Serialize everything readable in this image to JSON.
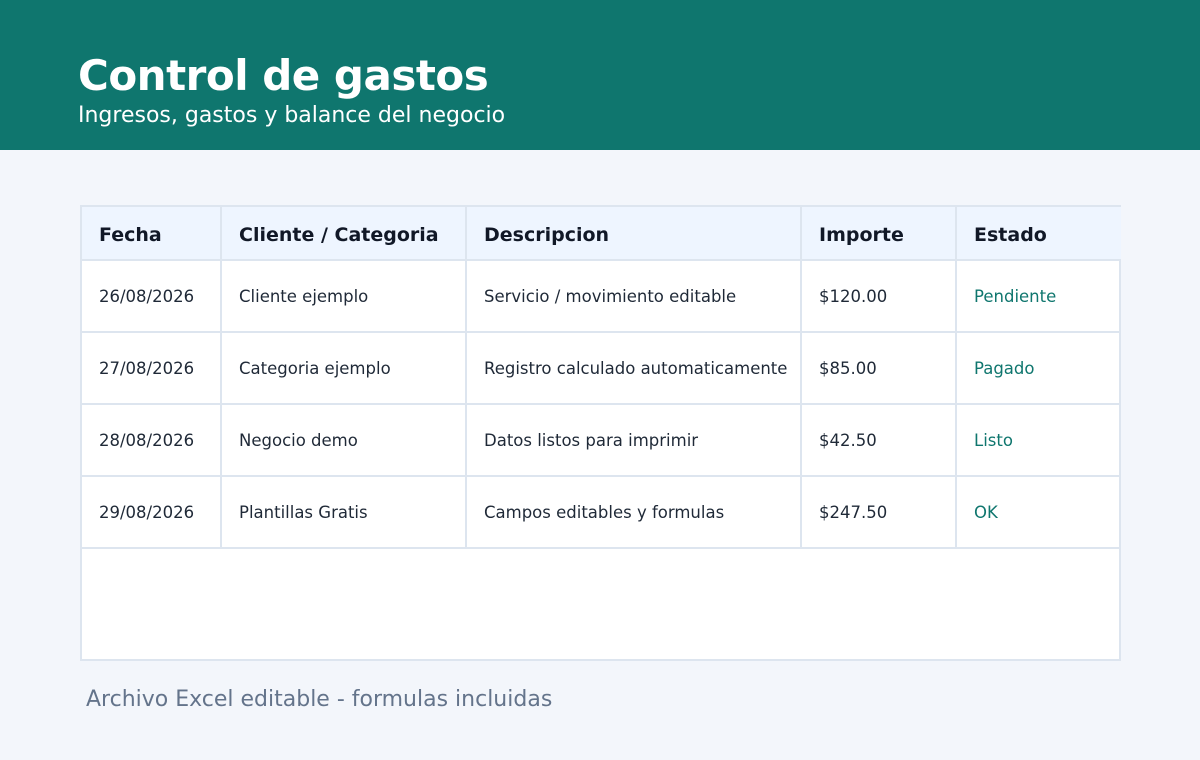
{
  "header": {
    "title": "Control de gastos",
    "subtitle": "Ingresos, gastos y balance del negocio"
  },
  "table": {
    "columns": [
      "Fecha",
      "Cliente / Categoria",
      "Descripcion",
      "Importe",
      "Estado"
    ],
    "rows": [
      [
        "26/08/2026",
        "Cliente ejemplo",
        "Servicio / movimiento editable",
        "$120.00",
        "Pendiente"
      ],
      [
        "27/08/2026",
        "Categoria ejemplo",
        "Registro calculado automaticamente",
        "$85.00",
        "Pagado"
      ],
      [
        "28/08/2026",
        "Negocio demo",
        "Datos listos para imprimir",
        "$42.50",
        "Listo"
      ],
      [
        "29/08/2026",
        "Plantillas Gratis",
        "Campos editables y formulas",
        "$247.50",
        "OK"
      ]
    ]
  },
  "footer": {
    "note": "Archivo Excel editable - formulas incluidas"
  },
  "colors": {
    "banner": "#0f766e",
    "page_background": "#f3f6fb",
    "header_row_background": "#eef5ff",
    "grid_border": "#dde5ef",
    "status_text": "#0f766e",
    "footnote_text": "#64748b"
  }
}
